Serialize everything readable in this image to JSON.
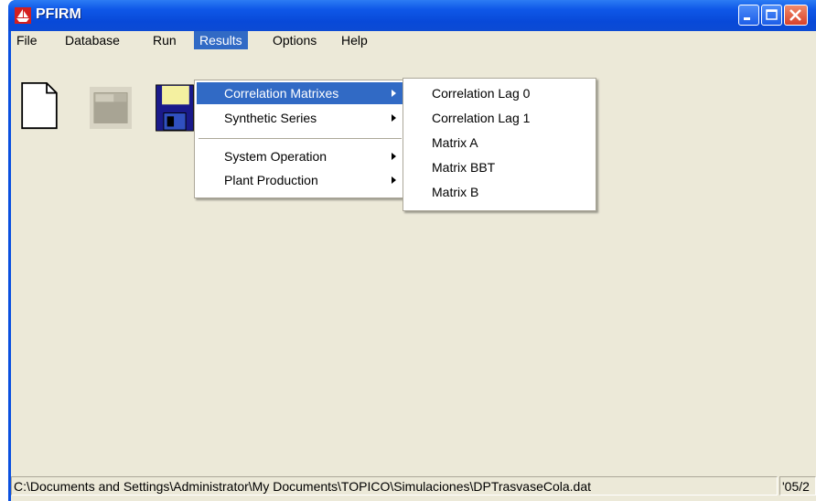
{
  "window": {
    "title": "PFIRM",
    "controls": {
      "minimize": "minimize",
      "maximize": "maximize",
      "close": "close"
    }
  },
  "menubar": {
    "items": [
      {
        "label": "File"
      },
      {
        "label": "Database"
      },
      {
        "label": "Run"
      },
      {
        "label": "Results",
        "active": true
      },
      {
        "label": "Options"
      },
      {
        "label": "Help"
      }
    ]
  },
  "toolbar": {
    "buttons": [
      {
        "icon": "new-document-icon"
      },
      {
        "icon": "open-folder-icon",
        "disabled": true
      },
      {
        "icon": "save-floppy-icon"
      }
    ]
  },
  "results_menu": {
    "items": [
      {
        "label": "Correlation Matrixes",
        "submenu": true,
        "highlighted": true
      },
      {
        "label": "Synthetic Series",
        "submenu": true
      },
      {
        "label": "System Operation",
        "submenu": true
      },
      {
        "label": "Plant Production",
        "submenu": true
      }
    ]
  },
  "correlation_submenu": {
    "items": [
      {
        "label": "Correlation Lag 0"
      },
      {
        "label": "Correlation Lag 1"
      },
      {
        "label": "Matrix A"
      },
      {
        "label": "Matrix BBT"
      },
      {
        "label": "Matrix B"
      }
    ]
  },
  "statusbar": {
    "path": "C:\\Documents and Settings\\Administrator\\My Documents\\TOPICO\\Simulaciones\\DPTrasvaseCola.dat",
    "date": "'05/2"
  },
  "colors": {
    "titlebar": "#0a50e0",
    "highlight": "#316ac5",
    "face": "#ece9d8"
  }
}
